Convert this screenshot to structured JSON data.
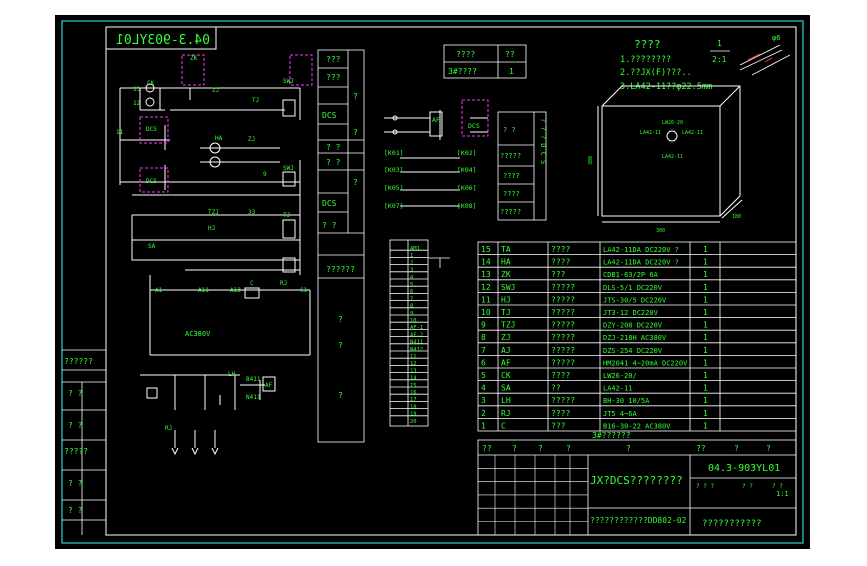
{
  "drawing_code_mirrored": "04.3-903YL01",
  "top_small_table": {
    "h1": "????",
    "h2": "??",
    "r1": "3#????",
    "r2": "1"
  },
  "notes": {
    "title": "????",
    "l1": "1.????????",
    "l2": "2.??JX(F)???..",
    "l3": "3.LA42-11??φ22.5mm"
  },
  "scale_box": {
    "top": "1",
    "bottom": "2:1"
  },
  "corner_mark": "φ6",
  "enclosure": {
    "label_h": "380",
    "label_w": "300",
    "label_d": "180",
    "b1": "LW26-20",
    "b2": "LA42-11",
    "b3": "LA42-11",
    "b4": "LA42-11"
  },
  "circuit": {
    "n13": "13",
    "n12": "12",
    "n11": "11",
    "ck": "CK",
    "zk": "ZK",
    "tzj": "TZJ",
    "zj": "ZJ",
    "zj2": "ZJ",
    "tj": "TJ",
    "tj2": "TJ",
    "sa": "SA",
    "hj": "HJ",
    "ha": "HA",
    "tl": "TL",
    "swj": "SWJ",
    "swj2": "SWJ",
    "lh": "LH",
    "a11": "A11",
    "a13": "A13",
    "c1": "C1",
    "ac380": "AC380V",
    "af": "AF",
    "b411": "B411",
    "n411": "N411",
    "rj": "RJ",
    "c": "C",
    "dcs1": "DCS",
    "dcs2": "DCS",
    "n33": "33",
    "n9": "9",
    "a1": "A1"
  },
  "mid_column": [
    "???",
    "???",
    "?",
    "DCS",
    "?",
    "? ?",
    "? ?",
    "DCS",
    "? ?",
    "?",
    "??????",
    "?",
    "?",
    "?"
  ],
  "dcs_block": {
    "k01": "[K01]",
    "k02": "[K02]",
    "k03": "[K03]",
    "k04": "[K04]",
    "k05": "[K05]",
    "k06": "[K06]",
    "k07": "[K07]",
    "k08": "[K08]",
    "dcs": "DCS",
    "af": "AF",
    "side": [
      "? ?",
      "?????",
      "????",
      "????",
      "?????"
    ],
    "side_v": "? ? ? D C S"
  },
  "terminal_labels": [
    "AM1",
    "1",
    "2",
    "3",
    "4",
    "5",
    "6",
    "7",
    "8",
    "9",
    "10",
    "AF-1",
    "AF-2",
    "N411",
    "N412",
    "11",
    "12",
    "13",
    "14",
    "15",
    "16",
    "17",
    "18",
    "19",
    "20"
  ],
  "bom": [
    [
      "15",
      "TA",
      "????",
      "LA42-11DA DC220V ?",
      "1"
    ],
    [
      "14",
      "HA",
      "????",
      "LA42-11DA DC220V ?",
      "1"
    ],
    [
      "13",
      "ZK",
      "???",
      "CDB1-63/2P 6A",
      "1"
    ],
    [
      "12",
      "SWJ",
      "?????",
      "DLS-5/1 DC220V",
      "1"
    ],
    [
      "11",
      "HJ",
      "?????",
      "JTS-30/5 DC220V",
      "1"
    ],
    [
      "10",
      "TJ",
      "?????",
      "JT3-12 DC220V",
      "1"
    ],
    [
      "9",
      "TZJ",
      "?????",
      "DZY-208 DC220V",
      "1"
    ],
    [
      "8",
      "ZJ",
      "?????",
      "DZJ-218H AC380V",
      "1"
    ],
    [
      "7",
      "AJ",
      "?????",
      "DZS-254 DC220V",
      "1"
    ],
    [
      "6",
      "AF",
      "?????",
      "HM2041 4~20mA DC220V",
      "1"
    ],
    [
      "5",
      "CK",
      "????",
      "LW26-20/",
      "1"
    ],
    [
      "4",
      "SA",
      "??",
      "LA42-11",
      "1"
    ],
    [
      "3",
      "LH",
      "?????",
      "BH-30 10/5A",
      "1"
    ],
    [
      "2",
      "RJ",
      "????",
      "JT5 4~6A",
      "1"
    ],
    [
      "1",
      "C",
      "???",
      "B16-30-22 AC380V",
      "1"
    ]
  ],
  "bom_footer": "3#??????",
  "bom_header": [
    "??",
    "?",
    "?",
    "?",
    "?",
    "??",
    "?",
    "?"
  ],
  "title_block": {
    "name": "JX?DCS????????",
    "code": "04.3-903YL01",
    "sub": "????????????DD802-02",
    "company": "???????????",
    "scale": "1:1",
    "cells": [
      "? ? ?",
      "? ?",
      "? ?"
    ]
  },
  "left_strip": [
    "??????",
    "?  ?",
    "?  ?",
    "?????",
    "?  ?",
    "?  ?"
  ],
  "colors": {
    "bg_outer": "#ffffff",
    "bg_inner": "#000000",
    "frame": "#2ad3d3",
    "line": "#ffffff",
    "text": "#33ff33",
    "magenta": "#ff33ff",
    "red": "#ff3333"
  }
}
